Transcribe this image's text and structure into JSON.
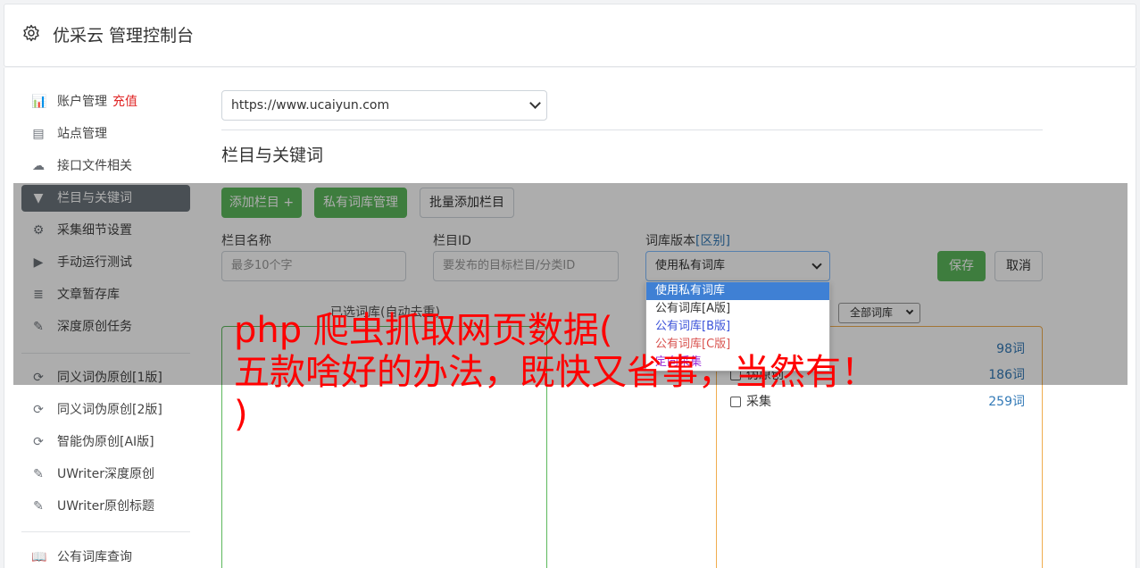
{
  "header": {
    "title": "优采云 管理控制台"
  },
  "sidebar": {
    "items": [
      {
        "label": "账户管理",
        "badge": "充值",
        "icon": "bar-chart-icon",
        "glyph": "📊"
      },
      {
        "label": "站点管理",
        "icon": "server-icon",
        "glyph": "▤"
      },
      {
        "label": "接口文件相关",
        "icon": "cloud-upload-icon",
        "glyph": "☁"
      },
      {
        "label": "栏目与关键词",
        "icon": "filter-icon",
        "glyph": "▼",
        "active": true
      },
      {
        "label": "采集细节设置",
        "icon": "gears-icon",
        "glyph": "⚙"
      },
      {
        "label": "手动运行测试",
        "icon": "play-circle-icon",
        "glyph": "▶"
      },
      {
        "label": "文章暂存库",
        "icon": "database-icon",
        "glyph": "≣"
      },
      {
        "label": "深度原创任务",
        "icon": "edit-icon",
        "glyph": "✎"
      },
      {
        "label": "同义词伪原创[1版]",
        "icon": "refresh-icon",
        "glyph": "⟳"
      },
      {
        "label": "同义词伪原创[2版]",
        "icon": "refresh-icon",
        "glyph": "⟳"
      },
      {
        "label": "智能伪原创[AI版]",
        "icon": "refresh-icon",
        "glyph": "⟳"
      },
      {
        "label": "UWriter深度原创",
        "icon": "edit-icon",
        "glyph": "✎"
      },
      {
        "label": "UWriter原创标题",
        "icon": "edit-icon",
        "glyph": "✎"
      },
      {
        "label": "公有词库查询",
        "icon": "book-icon",
        "glyph": "📖"
      }
    ]
  },
  "main": {
    "site_select": "https://www.ucaiyun.com",
    "section_title": "栏目与关键词",
    "buttons": {
      "add_column": "添加栏目 +",
      "private_lib": "私有词库管理",
      "batch_add": "批量添加栏目",
      "save": "保存",
      "cancel": "取消"
    },
    "fields": {
      "column_name_label": "栏目名称",
      "column_name_placeholder": "最多10个字",
      "column_id_label": "栏目ID",
      "column_id_placeholder": "要发布的目标栏目/分类ID",
      "lib_version_label": "词库版本",
      "lib_version_link": "[区别]",
      "lib_version_value": "使用私有词库"
    },
    "dropdown_options": [
      {
        "label": "使用私有词库",
        "color": "#ffffff"
      },
      {
        "label": "公有词库[A版]",
        "color": "#333333"
      },
      {
        "label": "公有词库[B版]",
        "color": "#3b52d9"
      },
      {
        "label": "公有词库[C版]",
        "color": "#d9534f"
      },
      {
        "label": "定向采集",
        "color": "#9b30d9"
      }
    ],
    "selected_libs_label": "已选词库(自动去重)",
    "all_libs_select": "全部词库",
    "libs": [
      {
        "name": "",
        "count": "98词"
      },
      {
        "name": "伪原创",
        "count": "186词"
      },
      {
        "name": "采集",
        "count": "259词"
      }
    ]
  },
  "overlay": {
    "text": "php 爬虫抓取网页数据(\n五款啥好的办法，既快又省事，当然有！\n)"
  }
}
